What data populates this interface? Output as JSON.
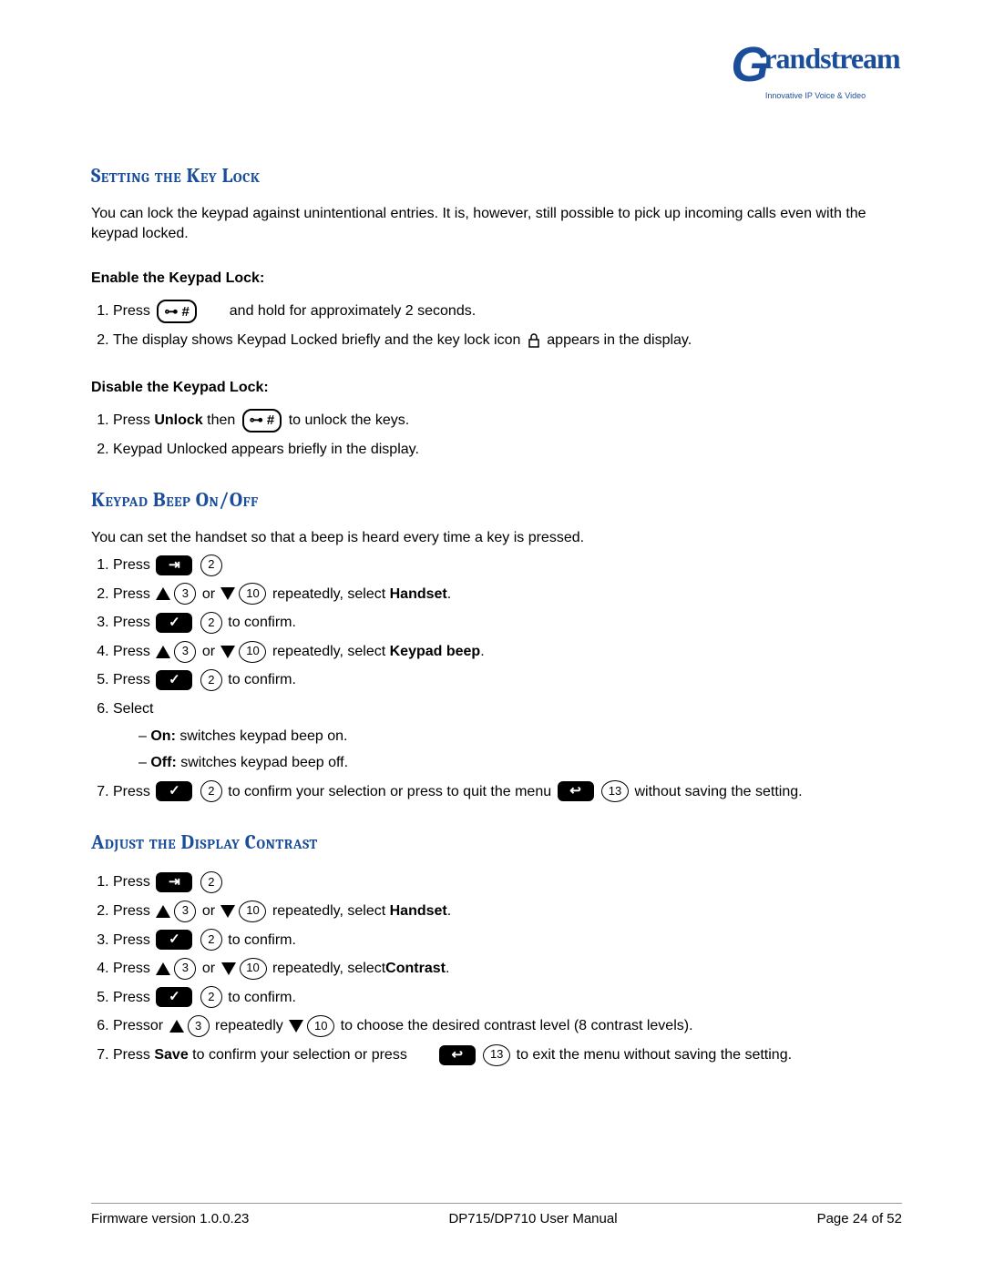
{
  "logo": {
    "brand_g": "G",
    "brand_rest": "randstream",
    "tagline": "Innovative IP Voice & Video"
  },
  "section1": {
    "title": "Setting the Key Lock",
    "intro": "You can lock the keypad against unintentional entries. It is, however, still possible to pick up incoming calls even with the keypad locked.",
    "enable_title": "Enable the Keypad Lock:",
    "step1a": "Press",
    "step1b": "and hold for approximately 2 seconds.",
    "step2a": "The display shows Keypad Locked briefly and the key lock icon",
    "step2b": "appears in the display.",
    "disable_title": "Disable the Keypad Lock:",
    "d1a": "Press ",
    "d1_unlock": "Unlock",
    "d1b": " then",
    "d1c": "to unlock the keys.",
    "d2": "Keypad Unlocked appears briefly in the display."
  },
  "section2": {
    "title": "Keypad Beep On/Off",
    "intro": "You can set the handset so that a beep is heard every time a key is pressed.",
    "s1": "Press",
    "s2a": "Press",
    "s2b": " or ",
    "s2c": "repeatedly, select ",
    "s2_bold": "Handset",
    "s2d": ".",
    "s3a": "Press",
    "s3b": "to confirm.",
    "s4a": "Press",
    "s4b": " or ",
    "s4c": "repeatedly, select ",
    "s4_bold": "Keypad beep",
    "s4d": ".",
    "s5a": "Press",
    "s5b": "to confirm.",
    "s6": "Select",
    "s6_on_a": "– ",
    "s6_on_b": "On:",
    "s6_on_c": " switches keypad beep on.",
    "s6_off_a": "– ",
    "s6_off_b": "Off:",
    "s6_off_c": " switches keypad beep off.",
    "s7a": "Press",
    "s7b": "to confirm your selection or press",
    "s7c": "to quit the menu",
    "s7d": "without saving the setting."
  },
  "section3": {
    "title": "Adjust the Display Contrast",
    "s1": "Press",
    "s2a": "Press",
    "s2b": " or ",
    "s2c": "repeatedly, select ",
    "s2_bold": "Handset",
    "s2d": ".",
    "s3a": "Press",
    "s3b": "to confirm.",
    "s4a": "Press",
    "s4b": "or",
    "s4c": "repeatedly, select",
    "s4_bold": "Contrast",
    "s4d": ".",
    "s5a": "Press",
    "s5b": "to confirm.",
    "s6a": "Pressor",
    "s6b": "repeatedly",
    "s6c": "to choose",
    "s6d": "the desired contrast level (8 contrast levels).",
    "s7a": "Press ",
    "s7_bold": "Save",
    "s7b": "to confirm your selection or press",
    "s7c": "to exit the menu without saving the setting."
  },
  "footer": {
    "left": "Firmware version 1.0.0.23",
    "center": "DP715/DP710 User Manual",
    "right": "Page 24 of 52"
  },
  "icons": {
    "key_hash": "⊶ #",
    "menu": "⇥",
    "check": "✓",
    "back": "↩",
    "n2": "2",
    "n3": "3",
    "n10": "10",
    "n13": "13"
  }
}
